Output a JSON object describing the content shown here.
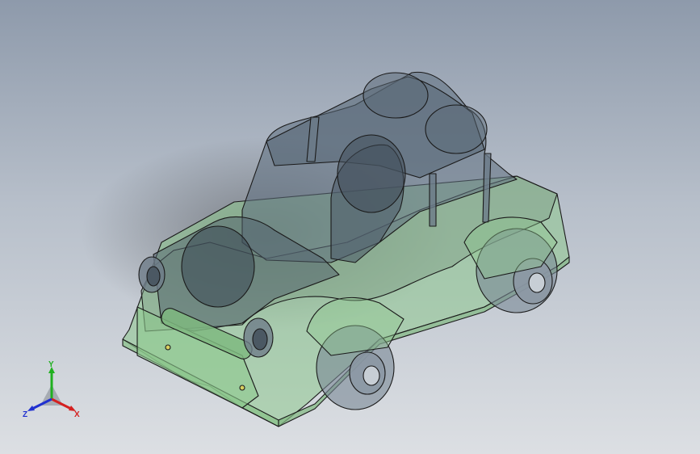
{
  "viewport": {
    "background_top": "#8e9aab",
    "background_bottom": "#dcdfe3",
    "model": {
      "shell_color": "#5f7080",
      "chassis_color": "#8ec98e",
      "edge_color": "#1a1a1a"
    }
  },
  "triad": {
    "x_label": "X",
    "y_label": "Y",
    "z_label": "Z",
    "x_color": "#d42020",
    "y_color": "#20b020",
    "z_color": "#2030d0"
  }
}
